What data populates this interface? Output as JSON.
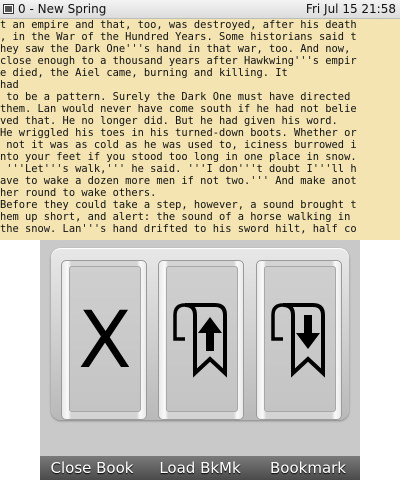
{
  "status": {
    "title": "0 - New Spring",
    "clock": "Fri Jul 15 21:58",
    "icon": "battery-icon"
  },
  "book": {
    "lines": [
      "t an empire and that, too, was destroyed, after his death",
      ", in the War of the Hundred Years. Some historians said t",
      "hey saw the Dark One'''s hand in that war, too. And now,",
      "close enough to a thousand years after Hawkwing'''s empir",
      "e died, the Aiel came, burning and killing. It",
      "had",
      " to be a pattern. Surely the Dark One must have directed",
      "them. Lan would never have come south if he had not belie",
      "ved that. He no longer did. But he had given his word.",
      "He wriggled his toes in his turned-down boots. Whether or",
      " not it was as cold as he was used to, iciness burrowed i",
      "nto your feet if you stood too long in one place in snow.",
      " '''Let'''s walk,''' he said. '''I don'''t doubt I'''ll h",
      "ave to wake a dozen more men if not two.''' And make anot",
      "her round to wake others.",
      "Before they could take a step, however, a sound brought t",
      "hem up short, and alert: the sound of a horse walking in",
      "the snow. Lan'''s hand drifted to his sword hilt, half co"
    ]
  },
  "dialog": {
    "buttons": [
      {
        "label": "Close Book",
        "icon": "close-x-icon"
      },
      {
        "label": "Load BkMk",
        "icon": "bookmark-load-icon"
      },
      {
        "label": "Bookmark",
        "icon": "bookmark-add-icon"
      }
    ],
    "close_glyph": "X"
  }
}
